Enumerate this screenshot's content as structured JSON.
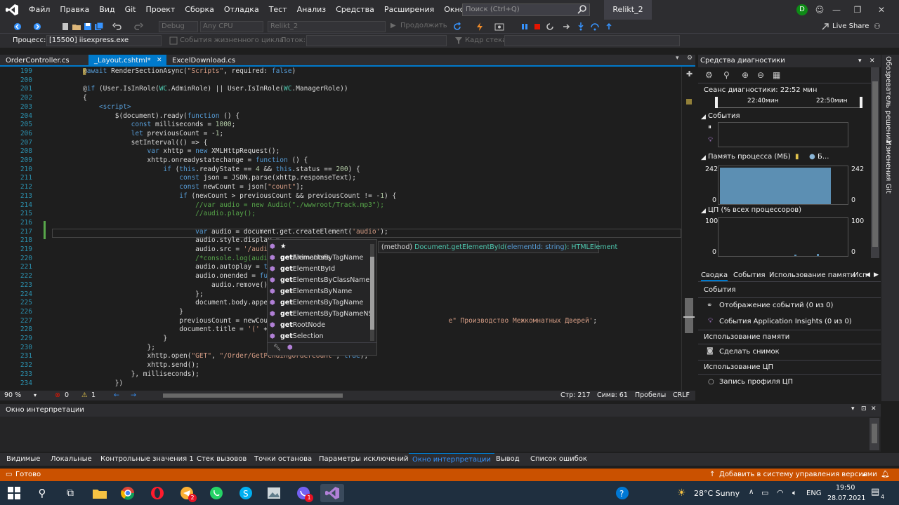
{
  "menubar": {
    "items": [
      "Файл",
      "Правка",
      "Вид",
      "Git",
      "Проект",
      "Сборка",
      "Отладка",
      "Тест",
      "Анализ",
      "Средства",
      "Расширения",
      "Окно",
      "Справка"
    ],
    "search_placeholder": "Поиск (Ctrl+Q)",
    "solution_title": "Relikt_2",
    "avatar_letter": "D"
  },
  "toolbar": {
    "config": "Debug",
    "platform": "Any CPU",
    "project": "Relikt_2",
    "continue_label": "Продолжить",
    "live_share": "Live Share"
  },
  "procbar": {
    "process_label": "Процесс:",
    "process_value": "[15500] iisexpress.exe",
    "lifecycle_label": "События жизненного цикла",
    "thread_label": "Поток:",
    "stack_label": "Кадр стека:"
  },
  "doctabs": [
    {
      "label": "OrderController.cs",
      "active": false
    },
    {
      "label": "_Layout.cshtml*",
      "active": true
    },
    {
      "label": "ExcelDownload.cs",
      "active": false
    }
  ],
  "code_lines": [
    {
      "n": "199",
      "html": "<span class='razor'>@</span><span class='kw'>await</span> RenderSectionAsync(<span class='str'>\"Scripts\"</span>, required: <span class='kw'>false</span>)"
    },
    {
      "n": "200",
      "html": ""
    },
    {
      "n": "201",
      "html": "<span class='razor'>@</span><span class='kw'>if</span> (User.IsInRole(<span class='cls'>WC</span>.AdminRole) || User.IsInRole(<span class='cls'>WC</span>.ManagerRole))"
    },
    {
      "n": "202",
      "html": "{"
    },
    {
      "n": "203",
      "html": "    <span class='kw'>&lt;script&gt;</span>"
    },
    {
      "n": "204",
      "html": "        $(document).ready(<span class='kw'>function</span> () {"
    },
    {
      "n": "205",
      "html": "            <span class='kw'>const</span> milliseconds = <span class='num'>1000</span>;"
    },
    {
      "n": "206",
      "html": "            <span class='kw'>let</span> previousCount = -<span class='num'>1</span>;"
    },
    {
      "n": "207",
      "html": "            setInterval(() =&gt; {"
    },
    {
      "n": "208",
      "html": "                <span class='kw'>var</span> xhttp = <span class='kw'>new</span> XMLHttpRequest();"
    },
    {
      "n": "209",
      "html": "                xhttp.onreadystatechange = <span class='kw'>function</span> () {"
    },
    {
      "n": "210",
      "html": "                    <span class='kw'>if</span> (<span class='kw'>this</span>.readyState == <span class='num'>4</span> &amp;&amp; <span class='kw'>this</span>.status == <span class='num'>200</span>) {"
    },
    {
      "n": "211",
      "html": "                        <span class='kw'>const</span> json = JSON.parse(xhttp.responseText);"
    },
    {
      "n": "212",
      "html": "                        <span class='kw'>const</span> newCount = json[<span class='str'>\"count\"</span>];"
    },
    {
      "n": "213",
      "html": "                        <span class='kw'>if</span> (newCount &gt; previousCount &amp;&amp; previousCount != -<span class='num'>1</span>) {"
    },
    {
      "n": "214",
      "html": "                            <span class='cm'>//var audio = new Audio(\"./wwwroot/Track.mp3\");</span>"
    },
    {
      "n": "215",
      "html": "                            <span class='cm'>//audio.play();</span>"
    },
    {
      "n": "216",
      "html": ""
    },
    {
      "n": "217",
      "html": "                            <span class='kw'>var</span> audio = document.get.createElement(<span class='str'>'audio'</span>);"
    },
    {
      "n": "218",
      "html": "                            audio.style.display ="
    },
    {
      "n": "219",
      "html": "                            audio.src = <span class='str'>'/audio/T</span>"
    },
    {
      "n": "220",
      "html": "                            <span class='cm'>/*console.log(audio);</span>"
    },
    {
      "n": "221",
      "html": "                            audio.autoplay = <span class='kw'>true</span>"
    },
    {
      "n": "222",
      "html": "                            audio.onended = <span class='kw'>funct</span>"
    },
    {
      "n": "223",
      "html": "                                audio.remove() <span class='cm'>//</span>"
    },
    {
      "n": "224",
      "html": "                            };"
    },
    {
      "n": "225",
      "html": "                            document.body.appendC"
    },
    {
      "n": "226",
      "html": "                        }"
    },
    {
      "n": "227",
      "html": "                        previousCount = newCount;                                          <span class='str'>e\" Производство Межкомнатных Дверей'</span>;"
    },
    {
      "n": "228",
      "html": "                        document.title = <span class='str'>'('</span> + js"
    },
    {
      "n": "229",
      "html": "                    }"
    },
    {
      "n": "230",
      "html": "                };"
    },
    {
      "n": "231",
      "html": "                xhttp.open(<span class='str'>\"GET\"</span>, <span class='str'>\"/Order/GetPendingOrderCount\"</span>, <span class='kw'>true</span>);"
    },
    {
      "n": "232",
      "html": "                xhttp.send();"
    },
    {
      "n": "233",
      "html": "            }, milliseconds);"
    },
    {
      "n": "234",
      "html": "        })"
    }
  ],
  "autocomplete": {
    "items": [
      {
        "bold": "get",
        "rest": "ElementsByTagName",
        "starred": true
      },
      {
        "bold": "get",
        "rest": "Animations",
        "starred": false
      },
      {
        "bold": "get",
        "rest": "ElementById",
        "starred": false
      },
      {
        "bold": "get",
        "rest": "ElementsByClassName",
        "starred": false
      },
      {
        "bold": "get",
        "rest": "ElementsByName",
        "starred": false
      },
      {
        "bold": "get",
        "rest": "ElementsByTagName",
        "starred": false
      },
      {
        "bold": "get",
        "rest": "ElementsByTagNameNS",
        "starred": false
      },
      {
        "bold": "get",
        "rest": "RootNode",
        "starred": false
      },
      {
        "bold": "get",
        "rest": "Selection",
        "starred": false
      }
    ],
    "tooltip_prefix": "(method) ",
    "tooltip_sig": "Document.getElementById(",
    "tooltip_param": "elementId: string",
    "tooltip_ret": "): HTMLElement"
  },
  "editor_status": {
    "zoom": "90 %",
    "errors": "0",
    "warnings": "1",
    "line": "Стр: 217",
    "col": "Симв: 61",
    "whitespace": "Пробелы",
    "eol": "CRLF"
  },
  "diagnostics": {
    "title": "Средства диагностики",
    "session": "Сеанс диагностики: 22:52 мин",
    "time_ticks": [
      "22:40мин",
      "22:50мин"
    ],
    "events_label": "События",
    "memory_label": "Память процесса (МБ)",
    "memory_legend": "Б...",
    "mem_max": "242",
    "mem_min": "0",
    "cpu_label": "ЦП (% всех процессоров)",
    "cpu_max": "100",
    "cpu_min": "0",
    "tabs": [
      "Сводка",
      "События",
      "Использование памяти",
      "Исп"
    ],
    "sec_events": "События",
    "events_display": "Отображение событий (0 из 0)",
    "app_insights": "События Application Insights (0 из 0)",
    "sec_memory": "Использование памяти",
    "snapshot": "Сделать снимок",
    "sec_cpu": "Использование ЦП",
    "cpu_profile": "Запись профиля ЦП"
  },
  "sidebar": {
    "solution_explorer": "Обозреватель решений",
    "git_changes": "Изменения Git"
  },
  "output": {
    "title": "Окно интерпретации"
  },
  "bottom_tabs": [
    "Видимые",
    "Локальные",
    "Контрольные значения 1",
    "Стек вызовов",
    "Точки останова",
    "Параметры исключений",
    "Окно интерпретации",
    "Вывод",
    "Список ошибок"
  ],
  "statusbar": {
    "ready": "Готово",
    "source_control": "Добавить в систему управления версиями"
  },
  "taskbar": {
    "weather": "28°C  Sunny",
    "lang": "ENG",
    "time": "19:50",
    "date": "28.07.2021",
    "notif": "4",
    "badge_a": "2",
    "badge_b": "1"
  },
  "colors": {
    "accent": "#007acc",
    "status": "#ca5100"
  }
}
